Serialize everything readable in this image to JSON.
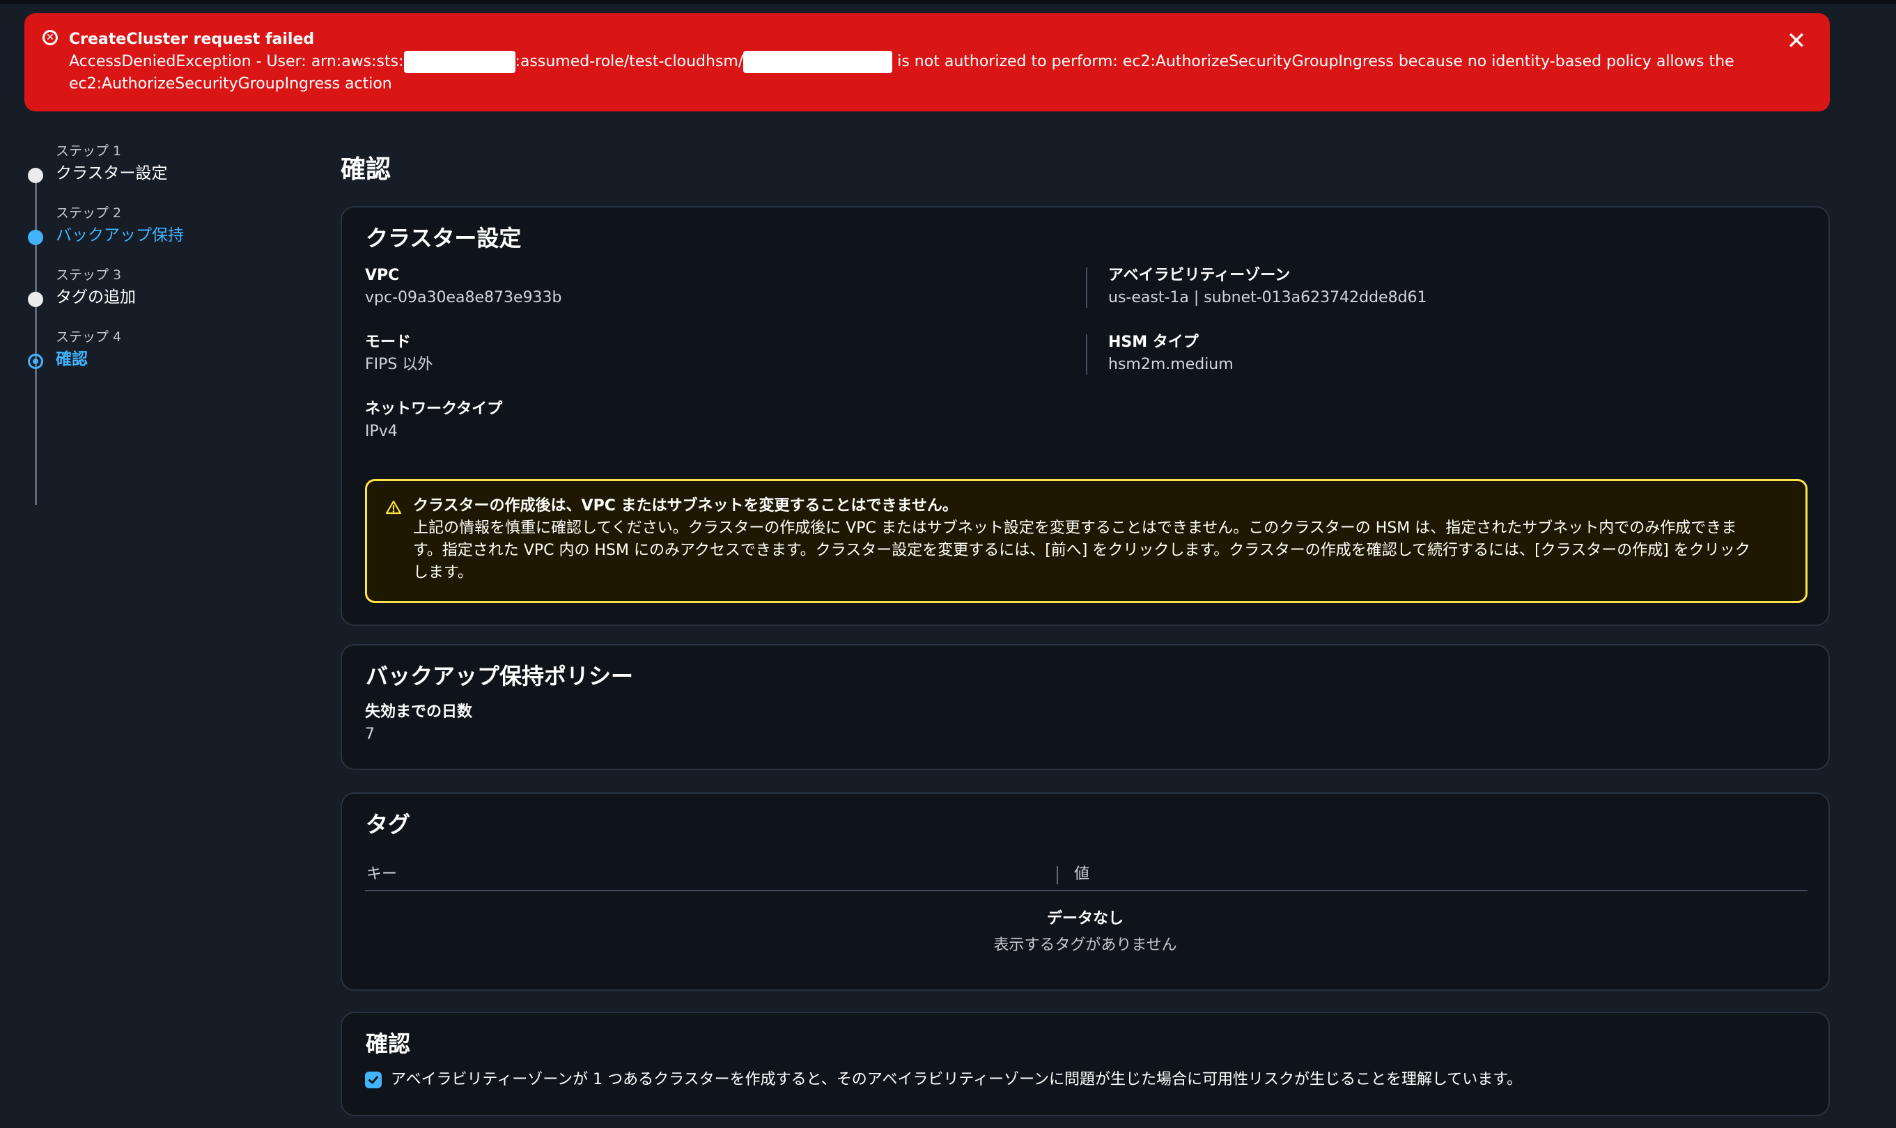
{
  "flash": {
    "title": "CreateCluster request failed",
    "line1_a": "AccessDeniedException - User: arn:aws:sts:",
    "line1_b": ":assumed-role/test-cloudhsm/",
    "line1_c": " is not authorized to perform: ec2:AuthorizeSecurityGroupIngress because no identity-based policy allows the",
    "line2": "ec2:AuthorizeSecurityGroupIngress action",
    "close_icon": "close-icon",
    "status_icon": "error-icon"
  },
  "steps": [
    {
      "label": "ステップ 1",
      "name": "クラスター設定",
      "state": "done"
    },
    {
      "label": "ステップ 2",
      "name": "バックアップ保持",
      "state": "active"
    },
    {
      "label": "ステップ 3",
      "name": "タグの追加",
      "state": "done"
    },
    {
      "label": "ステップ 4",
      "name": "確認",
      "state": "current"
    }
  ],
  "page": {
    "title": "確認"
  },
  "cluster_settings": {
    "title": "クラスター設定",
    "vpc_label": "VPC",
    "vpc_value": "vpc-09a30ea8e873e933b",
    "az_label": "アベイラビリティーゾーン",
    "az_value": "us-east-1a | subnet-013a623742dde8d61",
    "mode_label": "モード",
    "mode_value": "FIPS 以外",
    "hsm_label": "HSM タイプ",
    "hsm_value": "hsm2m.medium",
    "network_label": "ネットワークタイプ",
    "network_value": "IPv4",
    "warning": {
      "title": "クラスターの作成後は、VPC またはサブネットを変更することはできません。",
      "body1": "上記の情報を慎重に確認してください。クラスターの作成後に VPC またはサブネット設定を変更することはできません。このクラスターの HSM は、指定されたサブネット内でのみ作成できま",
      "body2": "す。指定された VPC 内の HSM にのみアクセスできます。クラスター設定を変更するには、[前へ] をクリックします。クラスターの作成を確認して続行するには、[クラスターの作成] をクリック",
      "body3": "します。"
    }
  },
  "backup": {
    "title": "バックアップ保持ポリシー",
    "days_label": "失効までの日数",
    "days_value": "7"
  },
  "tags": {
    "title": "タグ",
    "col_key": "キー",
    "col_value": "値",
    "empty_title": "データなし",
    "empty_desc": "表示するタグがありません"
  },
  "confirm": {
    "title": "確認",
    "checked": true,
    "label": "アベイラビリティーゾーンが 1 つあるクラスターを作成すると、そのアベイラビリティーゾーンに問題が生じた場合に可用性リスクが生じることを理解しています。"
  },
  "colors": {
    "error": "#d91515",
    "accent": "#42b4ff",
    "warning": "#ffe347",
    "background": "#161d26"
  }
}
